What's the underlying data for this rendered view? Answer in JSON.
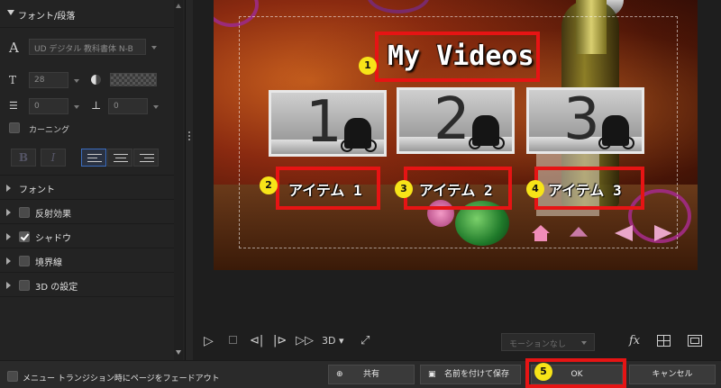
{
  "left_panel": {
    "section_title": "フォント/段落",
    "font_name": "UD デジタル 教科書体 N-B",
    "font_size": "28",
    "line_spacing": "0",
    "char_spacing": "0",
    "kerning_label": "カーニング",
    "bold_label": "B",
    "italic_label": "I",
    "list_items": [
      {
        "label": "フォント",
        "checkbox": false,
        "checked": false
      },
      {
        "label": "反射効果",
        "checkbox": true,
        "checked": false
      },
      {
        "label": "シャドウ",
        "checkbox": true,
        "checked": true
      },
      {
        "label": "境界線",
        "checkbox": true,
        "checked": false
      },
      {
        "label": "3D の設定",
        "checkbox": true,
        "checked": false
      }
    ]
  },
  "preview": {
    "title": "My Videos",
    "items": [
      {
        "thumb_number": "1",
        "label": "アイテム 1"
      },
      {
        "thumb_number": "2",
        "label": "アイテム 2"
      },
      {
        "thumb_number": "3",
        "label": "アイテム 3"
      }
    ],
    "badges": [
      "1",
      "2",
      "3",
      "4",
      "5"
    ]
  },
  "playback": {
    "three_d_label": "3D",
    "motion_placeholder": "モーションなし",
    "fx_label": "fx"
  },
  "bottom_bar": {
    "fade_label": "メニュー トランジション時にページをフェードアウト",
    "share_label": "共有",
    "save_as_label": "名前を付けて保存",
    "ok_label": "OK",
    "cancel_label": "キャンセル"
  },
  "colors": {
    "highlight_red": "#e61414",
    "badge_yellow": "#f7e418",
    "accent_blue": "#3b6dbf"
  }
}
